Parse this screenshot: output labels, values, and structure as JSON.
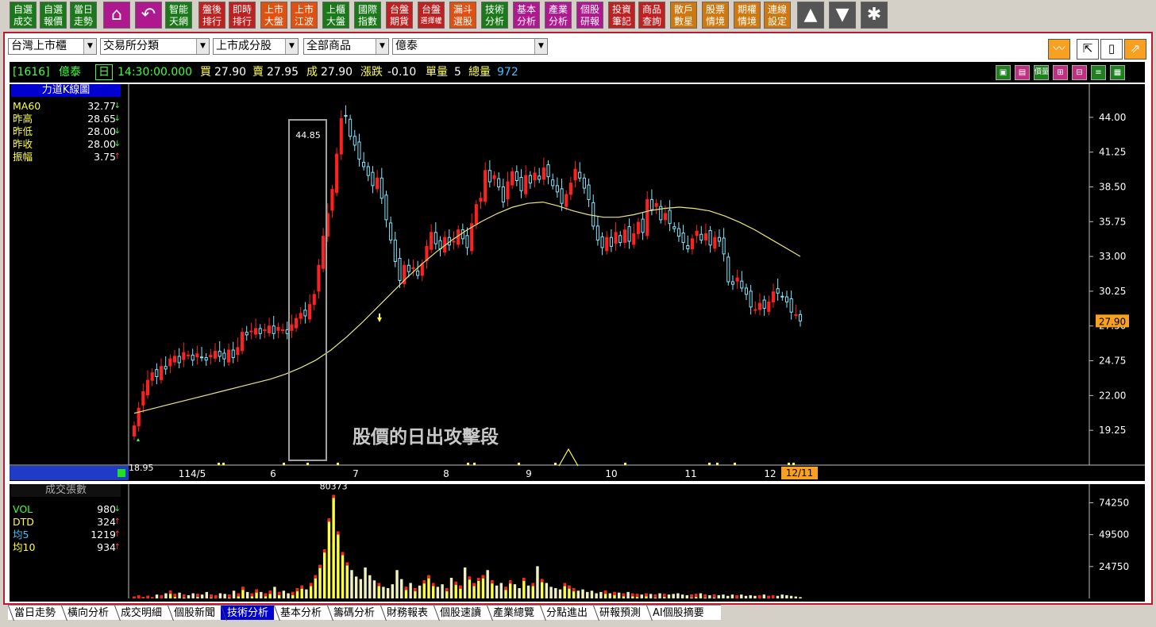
{
  "toolbar": {
    "buttons": [
      {
        "l1": "自選",
        "l2": "成交",
        "color": "#1a7a1a"
      },
      {
        "l1": "自選",
        "l2": "報價",
        "color": "#1a7a1a"
      },
      {
        "l1": "當日",
        "l2": "走勢",
        "color": "#1a7a1a"
      },
      {
        "l1": "智能",
        "l2": "天網",
        "color": "#1a7a1a"
      },
      {
        "l1": "盤後",
        "l2": "排行",
        "color": "#c02020"
      },
      {
        "l1": "即時",
        "l2": "排行",
        "color": "#c02020"
      },
      {
        "l1": "上市",
        "l2": "大盤",
        "color": "#e05010"
      },
      {
        "l1": "上市",
        "l2": "江波",
        "color": "#e05010"
      },
      {
        "l1": "上櫃",
        "l2": "大盤",
        "color": "#1a7a1a"
      },
      {
        "l1": "國際",
        "l2": "指數",
        "color": "#1a7a1a"
      },
      {
        "l1": "台盤",
        "l2": "期貨",
        "color": "#c02020"
      },
      {
        "l1": "台盤",
        "l2": "選擇權",
        "color": "#c02020"
      },
      {
        "l1": "漏斗",
        "l2": "選股",
        "color": "#e05010"
      },
      {
        "l1": "技術",
        "l2": "分析",
        "color": "#1a7a1a"
      },
      {
        "l1": "基本",
        "l2": "分析",
        "color": "#b01890"
      },
      {
        "l1": "產業",
        "l2": "分析",
        "color": "#b01890"
      },
      {
        "l1": "個股",
        "l2": "研報",
        "color": "#b01890"
      },
      {
        "l1": "投資",
        "l2": "筆記",
        "color": "#c02020"
      },
      {
        "l1": "商品",
        "l2": "查詢",
        "color": "#c02020"
      },
      {
        "l1": "散戶",
        "l2": "數星",
        "color": "#d07810"
      },
      {
        "l1": "股票",
        "l2": "情境",
        "color": "#d07810"
      },
      {
        "l1": "期權",
        "l2": "情境",
        "color": "#d07810"
      },
      {
        "l1": "連線",
        "l2": "設定",
        "color": "#d07810"
      }
    ],
    "icons": {
      "home": "⌂",
      "back": "↶",
      "up": "▲",
      "down": "▼",
      "star": "✱"
    }
  },
  "selectors": {
    "market": "台灣上市櫃",
    "category": "交易所分類",
    "index": "上市成分股",
    "product": "全部商品",
    "stock": "億泰"
  },
  "quote": {
    "code": "[1616]",
    "name": "億泰",
    "period": "日",
    "time": "14:30:00.000",
    "bid_label": "買",
    "bid": "27.90",
    "ask_label": "賣",
    "ask": "27.95",
    "last_label": "成",
    "last": "27.90",
    "change_label": "漲跌",
    "change": "-0.10",
    "unit_vol_label": "單量",
    "unit_vol": "5",
    "total_vol_label": "總量",
    "total_vol": "972"
  },
  "price_indicator": {
    "title": "力道K線圖",
    "rows": [
      {
        "label": "MA60",
        "value": "32.77",
        "arrow": "↓",
        "color": "#ffff40"
      },
      {
        "label": "昨高",
        "value": "28.65",
        "arrow": "↓",
        "color": "#ffff40"
      },
      {
        "label": "昨低",
        "value": "28.00",
        "arrow": "↓",
        "color": "#ffff40"
      },
      {
        "label": "昨收",
        "value": "28.00",
        "arrow": "↓",
        "color": "#ffff40"
      },
      {
        "label": "振幅",
        "value": "3.75",
        "arrow": "↑",
        "color": "#ffff40"
      }
    ]
  },
  "volume_indicator": {
    "title": "成交張數",
    "rows": [
      {
        "label": "VOL",
        "value": "980",
        "arrow": "↓",
        "color": "#40ff40"
      },
      {
        "label": "DTD",
        "value": "324",
        "arrow": "↑",
        "color": "#ffff40"
      },
      {
        "label": "均5",
        "value": "1219",
        "arrow": "↑",
        "color": "#40c0ff"
      },
      {
        "label": "均10",
        "value": "934",
        "arrow": "↑",
        "color": "#ffff40"
      }
    ]
  },
  "annotation": "股價的日出攻擊段",
  "chart_data": [
    {
      "type": "candlestick",
      "title": "力道K線圖",
      "x_labels": [
        "114/5",
        "6",
        "7",
        "8",
        "9",
        "10",
        "11",
        "12"
      ],
      "current_date_label": "12/11",
      "y_ticks": [
        44.0,
        41.25,
        38.5,
        35.75,
        33.0,
        30.25,
        27.5,
        24.75,
        22.0,
        19.25
      ],
      "ylim": [
        16.5,
        46.5
      ],
      "current_price": "27.90",
      "labels": {
        "high": "44.85",
        "low": "18.95"
      },
      "series": [
        {
          "name": "K",
          "closes": [
            19.6,
            21.0,
            22.3,
            23.2,
            23.8,
            23.5,
            24.3,
            24.1,
            24.9,
            25.1,
            24.6,
            25.4,
            25.2,
            24.8,
            25.3,
            25.0,
            24.8,
            25.2,
            25.5,
            25.1,
            24.9,
            25.6,
            25.0,
            25.8,
            27.0,
            26.8,
            27.1,
            27.3,
            26.9,
            27.2,
            27.5,
            26.9,
            27.4,
            27.2,
            26.9,
            27.6,
            28.1,
            28.5,
            28.3,
            29.2,
            30.0,
            32.3,
            34.6,
            36.4,
            38.3,
            41.1,
            43.9,
            44.1,
            42.5,
            41.8,
            40.7,
            40.1,
            39.4,
            38.6,
            39.2,
            37.6,
            35.9,
            34.3,
            32.6,
            31.1,
            32.3,
            31.8,
            32.1,
            31.5,
            32.4,
            33.8,
            34.9,
            34.0,
            33.6,
            34.5,
            33.9,
            34.2,
            35.1,
            34.4,
            33.7,
            35.6,
            37.1,
            37.6,
            39.8,
            38.9,
            39.4,
            38.5,
            37.3,
            38.9,
            39.7,
            39.0,
            38.2,
            39.4,
            38.8,
            39.6,
            39.1,
            40.0,
            39.3,
            38.6,
            38.1,
            37.2,
            37.9,
            38.8,
            39.9,
            39.2,
            38.4,
            37.5,
            35.4,
            34.3,
            33.7,
            34.5,
            33.8,
            34.9,
            34.1,
            35.1,
            34.2,
            34.8,
            35.7,
            34.9,
            37.5,
            36.7,
            37.2,
            35.9,
            36.4,
            35.6,
            35.2,
            34.6,
            34.1,
            33.6,
            34.4,
            35.0,
            34.3,
            34.8,
            33.9,
            34.5,
            34.2,
            33.2,
            31.0,
            30.8,
            31.3,
            30.5,
            30.0,
            29.0,
            28.8,
            29.3,
            28.9,
            29.4,
            30.2,
            30.1,
            29.8,
            29.4,
            28.6,
            28.4,
            27.9
          ]
        },
        {
          "name": "MA60",
          "values": [
            20.6,
            20.9,
            21.2,
            21.5,
            21.8,
            22.1,
            22.4,
            22.7,
            23.0,
            23.3,
            23.7,
            24.2,
            24.8,
            25.6,
            26.6,
            27.7,
            28.9,
            30.1,
            31.3,
            32.4,
            33.4,
            34.3,
            35.1,
            35.8,
            36.4,
            36.9,
            37.2,
            37.3,
            37.0,
            36.6,
            36.3,
            36.1,
            36.1,
            36.3,
            36.6,
            36.8,
            36.9,
            36.8,
            36.6,
            36.2,
            35.7,
            35.1,
            34.4,
            33.7,
            33.0
          ]
        }
      ]
    },
    {
      "type": "bar",
      "title": "成交張數",
      "y_ticks": [
        74250,
        49500,
        24750
      ],
      "ylim": [
        0,
        85000
      ],
      "labels": {
        "max": "80373"
      },
      "series": [
        {
          "name": "VOL",
          "values": [
            1500,
            2500,
            1200,
            2000,
            1000,
            3000,
            2500,
            4000,
            6000,
            3500,
            4500,
            3000,
            2500,
            4000,
            3500,
            3000,
            5000,
            3000,
            2500,
            4000,
            3500,
            3000,
            6000,
            4000,
            9000,
            5000,
            4000,
            7000,
            5000,
            4000,
            6000,
            9000,
            5000,
            6000,
            4000,
            5000,
            8000,
            10000,
            7000,
            12000,
            18000,
            26000,
            38000,
            62000,
            80373,
            52000,
            36000,
            28000,
            22000,
            17000,
            15000,
            24000,
            18000,
            14000,
            12000,
            9000,
            8000,
            11000,
            22000,
            15000,
            9000,
            12000,
            8000,
            10000,
            14000,
            18000,
            12000,
            9000,
            11000,
            8000,
            16000,
            13000,
            10000,
            24000,
            17000,
            12000,
            16000,
            18000,
            22000,
            14000,
            10000,
            12000,
            9000,
            14000,
            11000,
            8000,
            16000,
            10000,
            12000,
            25000,
            15000,
            12000,
            9000,
            8000,
            7000,
            12000,
            10000,
            8000,
            6000,
            7000,
            5000,
            6000,
            4000,
            5000,
            6000,
            4000,
            5000,
            4500,
            4000,
            5000,
            4000,
            3500,
            3000,
            4000,
            3500,
            3000,
            4000,
            3500,
            3000,
            3500,
            4000,
            3000,
            2500,
            3000,
            3500,
            4000,
            3000,
            2500,
            3000,
            2500,
            3000,
            2000,
            3000,
            2500,
            3000,
            2000,
            2500,
            2000,
            2500,
            3000,
            2000,
            2500,
            2000,
            3000,
            2500,
            2000,
            1500,
            1000
          ]
        }
      ]
    }
  ],
  "tabs": [
    {
      "label": "當日走勢",
      "active": false
    },
    {
      "label": "橫向分析",
      "active": false
    },
    {
      "label": "成交明細",
      "active": false
    },
    {
      "label": "個股新聞",
      "active": false
    },
    {
      "label": "技術分析",
      "active": true
    },
    {
      "label": "基本分析",
      "active": false
    },
    {
      "label": "籌碼分析",
      "active": false
    },
    {
      "label": "財務報表",
      "active": false
    },
    {
      "label": "個股速讀",
      "active": false
    },
    {
      "label": "產業總覽",
      "active": false
    },
    {
      "label": "分點進出",
      "active": false
    },
    {
      "label": "研報預測",
      "active": false
    },
    {
      "label": "AI個股摘要",
      "active": false
    }
  ],
  "colors": {
    "up": "#ff2020",
    "down": "#80e8ff",
    "ma": "#e8e880",
    "axis": "#c0c0c0",
    "frame": "#c01830"
  }
}
